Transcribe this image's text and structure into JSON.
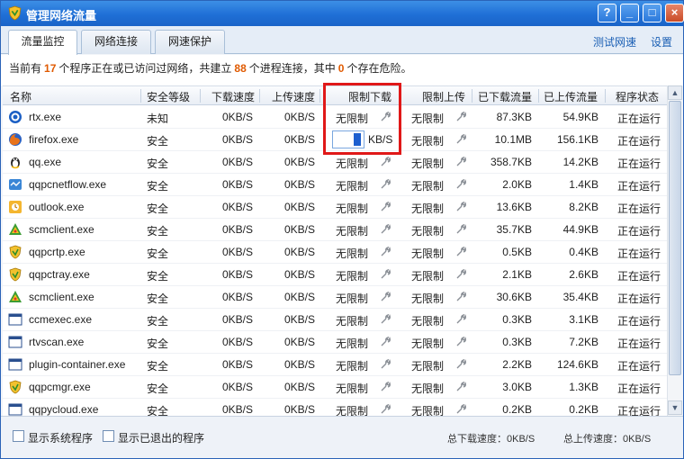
{
  "window": {
    "title": "管理网络流量",
    "help_glyph": "?",
    "min_glyph": "_",
    "max_glyph": "□",
    "close_glyph": "×"
  },
  "tabs": [
    {
      "label": "流量监控",
      "active": true
    },
    {
      "label": "网络连接",
      "active": false
    },
    {
      "label": "网速保护",
      "active": false
    }
  ],
  "links": {
    "speed_test": "测试网速",
    "settings": "设置"
  },
  "summary": {
    "p1": "当前有",
    "programs": "17",
    "p2": "个程序正在或已访问过网络，共建立",
    "connections": "88",
    "p3": "个进程连接，其中",
    "dangerous": "0",
    "p4": "个存在危险。"
  },
  "columns": [
    "名称",
    "安全等级",
    "下载速度",
    "上传速度",
    "限制下载",
    "限制上传",
    "已下载流量",
    "已上传流量",
    "程序状态"
  ],
  "edit": {
    "value": "0",
    "unit": "KB/S"
  },
  "rows": [
    {
      "icon": "rtx-icon",
      "name": "rtx.exe",
      "sec": "未知",
      "dl": "0KB/S",
      "ul": "0KB/S",
      "lim_dl": "无限制",
      "lim_ul": "无限制",
      "tdl": "87.3KB",
      "tul": "54.9KB",
      "status": "正在运行"
    },
    {
      "icon": "firefox-icon",
      "name": "firefox.exe",
      "sec": "安全",
      "dl": "0KB/S",
      "ul": "0KB/S",
      "lim_dl": "",
      "lim_ul": "无限制",
      "tdl": "10.1MB",
      "tul": "156.1KB",
      "status": "正在运行"
    },
    {
      "icon": "qq-icon",
      "name": "qq.exe",
      "sec": "安全",
      "dl": "0KB/S",
      "ul": "0KB/S",
      "lim_dl": "无限制",
      "lim_ul": "无限制",
      "tdl": "358.7KB",
      "tul": "14.2KB",
      "status": "正在运行"
    },
    {
      "icon": "qqpcnetflow-icon",
      "name": "qqpcnetflow.exe",
      "sec": "安全",
      "dl": "0KB/S",
      "ul": "0KB/S",
      "lim_dl": "无限制",
      "lim_ul": "无限制",
      "tdl": "2.0KB",
      "tul": "1.4KB",
      "status": "正在运行"
    },
    {
      "icon": "outlook-icon",
      "name": "outlook.exe",
      "sec": "安全",
      "dl": "0KB/S",
      "ul": "0KB/S",
      "lim_dl": "无限制",
      "lim_ul": "无限制",
      "tdl": "13.6KB",
      "tul": "8.2KB",
      "status": "正在运行"
    },
    {
      "icon": "scm-icon",
      "name": "scmclient.exe",
      "sec": "安全",
      "dl": "0KB/S",
      "ul": "0KB/S",
      "lim_dl": "无限制",
      "lim_ul": "无限制",
      "tdl": "35.7KB",
      "tul": "44.9KB",
      "status": "正在运行"
    },
    {
      "icon": "shield-icon",
      "name": "qqpcrtp.exe",
      "sec": "安全",
      "dl": "0KB/S",
      "ul": "0KB/S",
      "lim_dl": "无限制",
      "lim_ul": "无限制",
      "tdl": "0.5KB",
      "tul": "0.4KB",
      "status": "正在运行"
    },
    {
      "icon": "shield-icon",
      "name": "qqpctray.exe",
      "sec": "安全",
      "dl": "0KB/S",
      "ul": "0KB/S",
      "lim_dl": "无限制",
      "lim_ul": "无限制",
      "tdl": "2.1KB",
      "tul": "2.6KB",
      "status": "正在运行"
    },
    {
      "icon": "scm-icon",
      "name": "scmclient.exe",
      "sec": "安全",
      "dl": "0KB/S",
      "ul": "0KB/S",
      "lim_dl": "无限制",
      "lim_ul": "无限制",
      "tdl": "30.6KB",
      "tul": "35.4KB",
      "status": "正在运行"
    },
    {
      "icon": "window-icon",
      "name": "ccmexec.exe",
      "sec": "安全",
      "dl": "0KB/S",
      "ul": "0KB/S",
      "lim_dl": "无限制",
      "lim_ul": "无限制",
      "tdl": "0.3KB",
      "tul": "3.1KB",
      "status": "正在运行"
    },
    {
      "icon": "window-icon",
      "name": "rtvscan.exe",
      "sec": "安全",
      "dl": "0KB/S",
      "ul": "0KB/S",
      "lim_dl": "无限制",
      "lim_ul": "无限制",
      "tdl": "0.3KB",
      "tul": "7.2KB",
      "status": "正在运行"
    },
    {
      "icon": "window-icon",
      "name": "plugin-container.exe",
      "sec": "安全",
      "dl": "0KB/S",
      "ul": "0KB/S",
      "lim_dl": "无限制",
      "lim_ul": "无限制",
      "tdl": "2.2KB",
      "tul": "124.6KB",
      "status": "正在运行"
    },
    {
      "icon": "shield-icon",
      "name": "qqpcmgr.exe",
      "sec": "安全",
      "dl": "0KB/S",
      "ul": "0KB/S",
      "lim_dl": "无限制",
      "lim_ul": "无限制",
      "tdl": "3.0KB",
      "tul": "1.3KB",
      "status": "正在运行"
    },
    {
      "icon": "window-icon",
      "name": "qqpycloud.exe",
      "sec": "安全",
      "dl": "0KB/S",
      "ul": "0KB/S",
      "lim_dl": "无限制",
      "lim_ul": "无限制",
      "tdl": "0.2KB",
      "tul": "0.2KB",
      "status": "正在运行"
    }
  ],
  "scroll": {
    "up_glyph": "▲",
    "down_glyph": "▼"
  },
  "footer": {
    "show_system": "显示系统程序",
    "show_exited": "显示已退出的程序",
    "total_dl": "总下载速度：0KB/S",
    "total_ul": "总上传速度：0KB/S"
  },
  "colors": {
    "highlight_box": "#e01818",
    "count_number": "#e05a00",
    "link": "#1a5fb4",
    "titlebar": "#1f6fd6"
  }
}
